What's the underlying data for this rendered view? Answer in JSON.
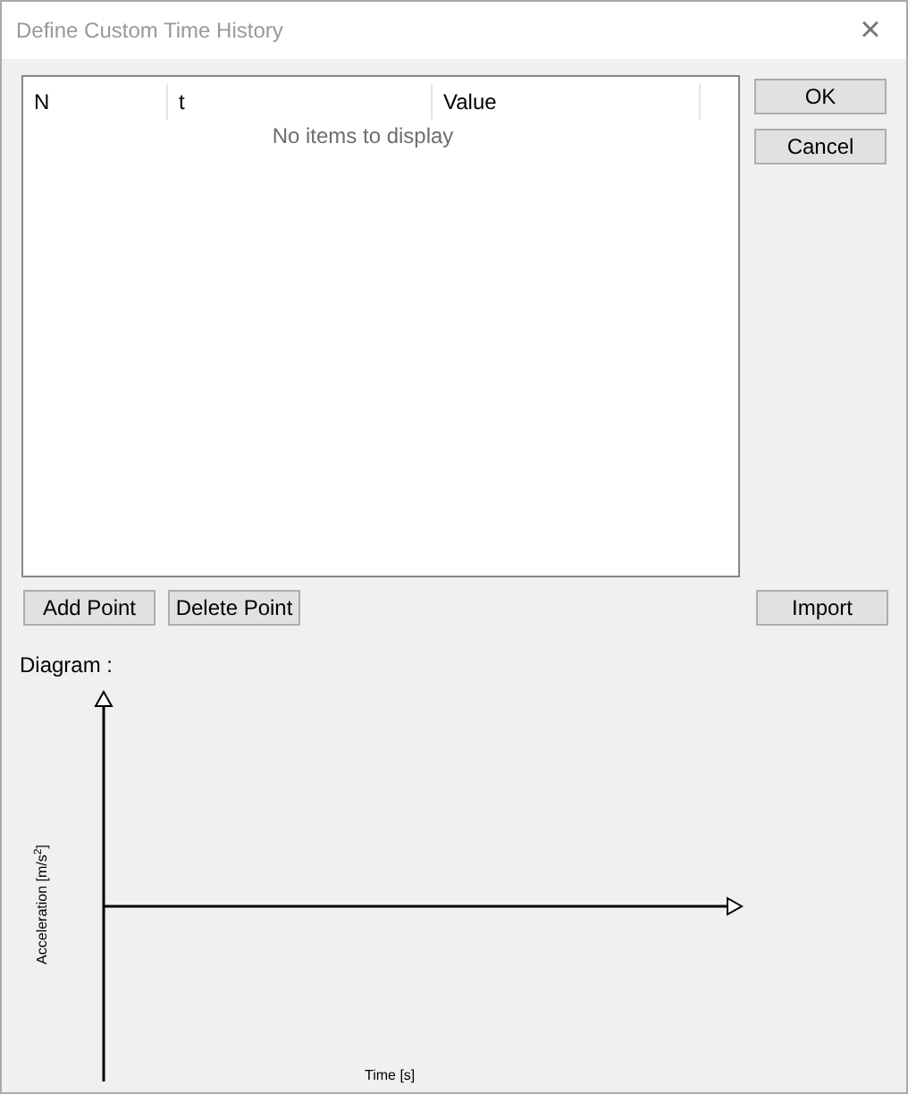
{
  "window": {
    "title": "Define Custom Time History",
    "close": "×"
  },
  "table": {
    "columns": [
      "N",
      "t",
      "Value"
    ],
    "empty_message": "No items to display"
  },
  "side_buttons": [
    "OK",
    "Cancel"
  ],
  "list_buttons": [
    "Add Point",
    "Delete Point"
  ],
  "import_button": "Import",
  "diagram": {
    "label": "Diagram :",
    "ylabel": "Acceleration [m/s$^{2}$]",
    "xlabel": "Time [s]"
  }
}
